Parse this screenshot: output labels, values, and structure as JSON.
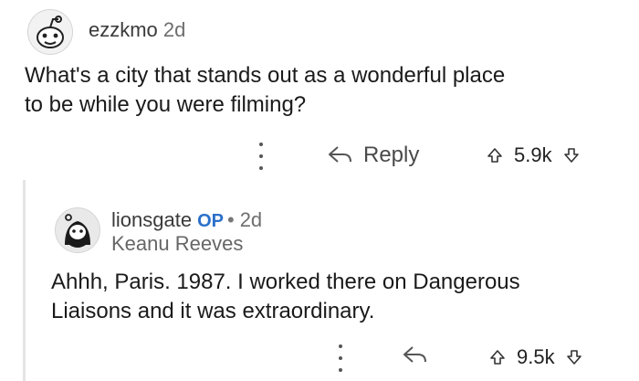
{
  "top_comment": {
    "username": "ezzkmo",
    "age": "2d",
    "body": "What's a city that stands out as a wonderful place\nto be while you were filming?",
    "reply_label": "Reply",
    "score": "5.9k"
  },
  "reply_comment": {
    "username": "lionsgate",
    "op_badge": "OP",
    "separator": "•",
    "age": "2d",
    "flair": "Keanu Reeves",
    "body": "Ahhh, Paris. 1987. I worked there on Dangerous\nLiaisons and it was extraordinary.",
    "score": "9.5k"
  },
  "icons": {
    "avatar_top": "reddit-snoo-avatar-icon",
    "avatar_reply": "bearded-avatar-icon",
    "more": "more-options-icon",
    "reply": "reply-arrow-icon",
    "upvote": "upvote-arrow-icon",
    "downvote": "downvote-arrow-icon"
  },
  "colors": {
    "op_badge": "#2b70c9",
    "thread_line": "#e4e4e4"
  }
}
